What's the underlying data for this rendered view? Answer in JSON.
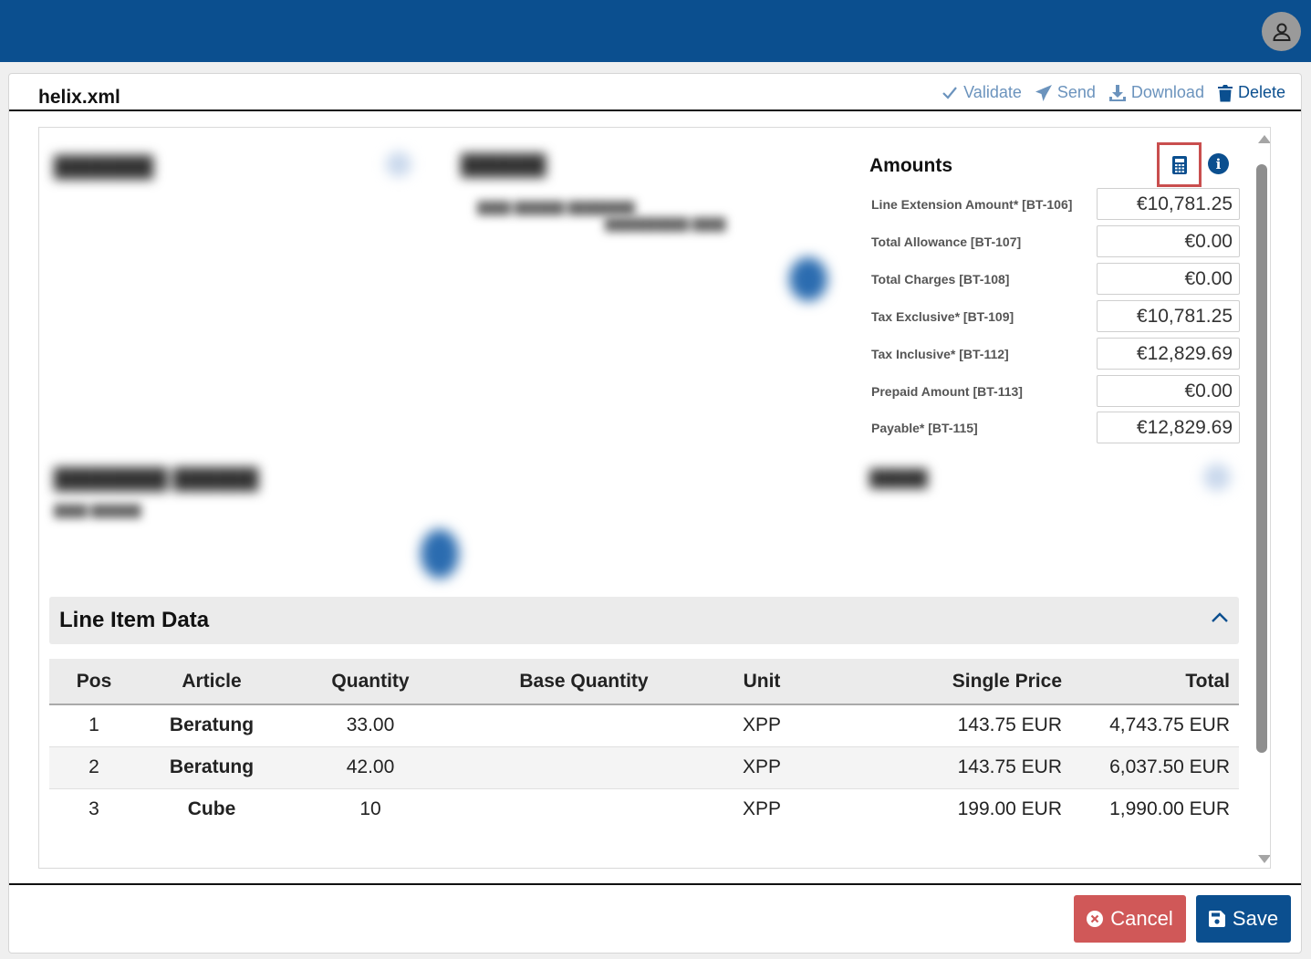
{
  "header": {
    "user_icon": "user-icon"
  },
  "document": {
    "file_name": "helix.xml"
  },
  "toolbar": {
    "validate_label": "Validate",
    "send_label": "Send",
    "download_label": "Download",
    "delete_label": "Delete"
  },
  "amounts": {
    "title": "Amounts",
    "rows": [
      {
        "label": "Line Extension Amount* [BT-106]",
        "value": "€10,781.25"
      },
      {
        "label": "Total Allowance [BT-107]",
        "value": "€0.00"
      },
      {
        "label": "Total Charges [BT-108]",
        "value": "€0.00"
      },
      {
        "label": "Tax Exclusive* [BT-109]",
        "value": "€10,781.25"
      },
      {
        "label": "Tax Inclusive* [BT-112]",
        "value": "€12,829.69"
      },
      {
        "label": "Prepaid Amount [BT-113]",
        "value": "€0.00"
      },
      {
        "label": "Payable* [BT-115]",
        "value": "€12,829.69"
      }
    ]
  },
  "line_items": {
    "title": "Line Item Data",
    "columns": [
      "Pos",
      "Article",
      "Quantity",
      "Base Quantity",
      "Unit",
      "Single Price",
      "Total"
    ],
    "rows": [
      {
        "pos": "1",
        "article": "Beratung",
        "quantity": "33.00",
        "base_quantity": "",
        "unit": "XPP",
        "single_price": "143.75 EUR",
        "total": "4,743.75 EUR"
      },
      {
        "pos": "2",
        "article": "Beratung",
        "quantity": "42.00",
        "base_quantity": "",
        "unit": "XPP",
        "single_price": "143.75 EUR",
        "total": "6,037.50 EUR"
      },
      {
        "pos": "3",
        "article": "Cube",
        "quantity": "10",
        "base_quantity": "",
        "unit": "XPP",
        "single_price": "199.00 EUR",
        "total": "1,990.00 EUR"
      }
    ]
  },
  "footer": {
    "cancel_label": "Cancel",
    "save_label": "Save"
  },
  "colors": {
    "brand": "#0b4f8f",
    "danger": "#d05858",
    "highlight": "#c94e4e"
  }
}
